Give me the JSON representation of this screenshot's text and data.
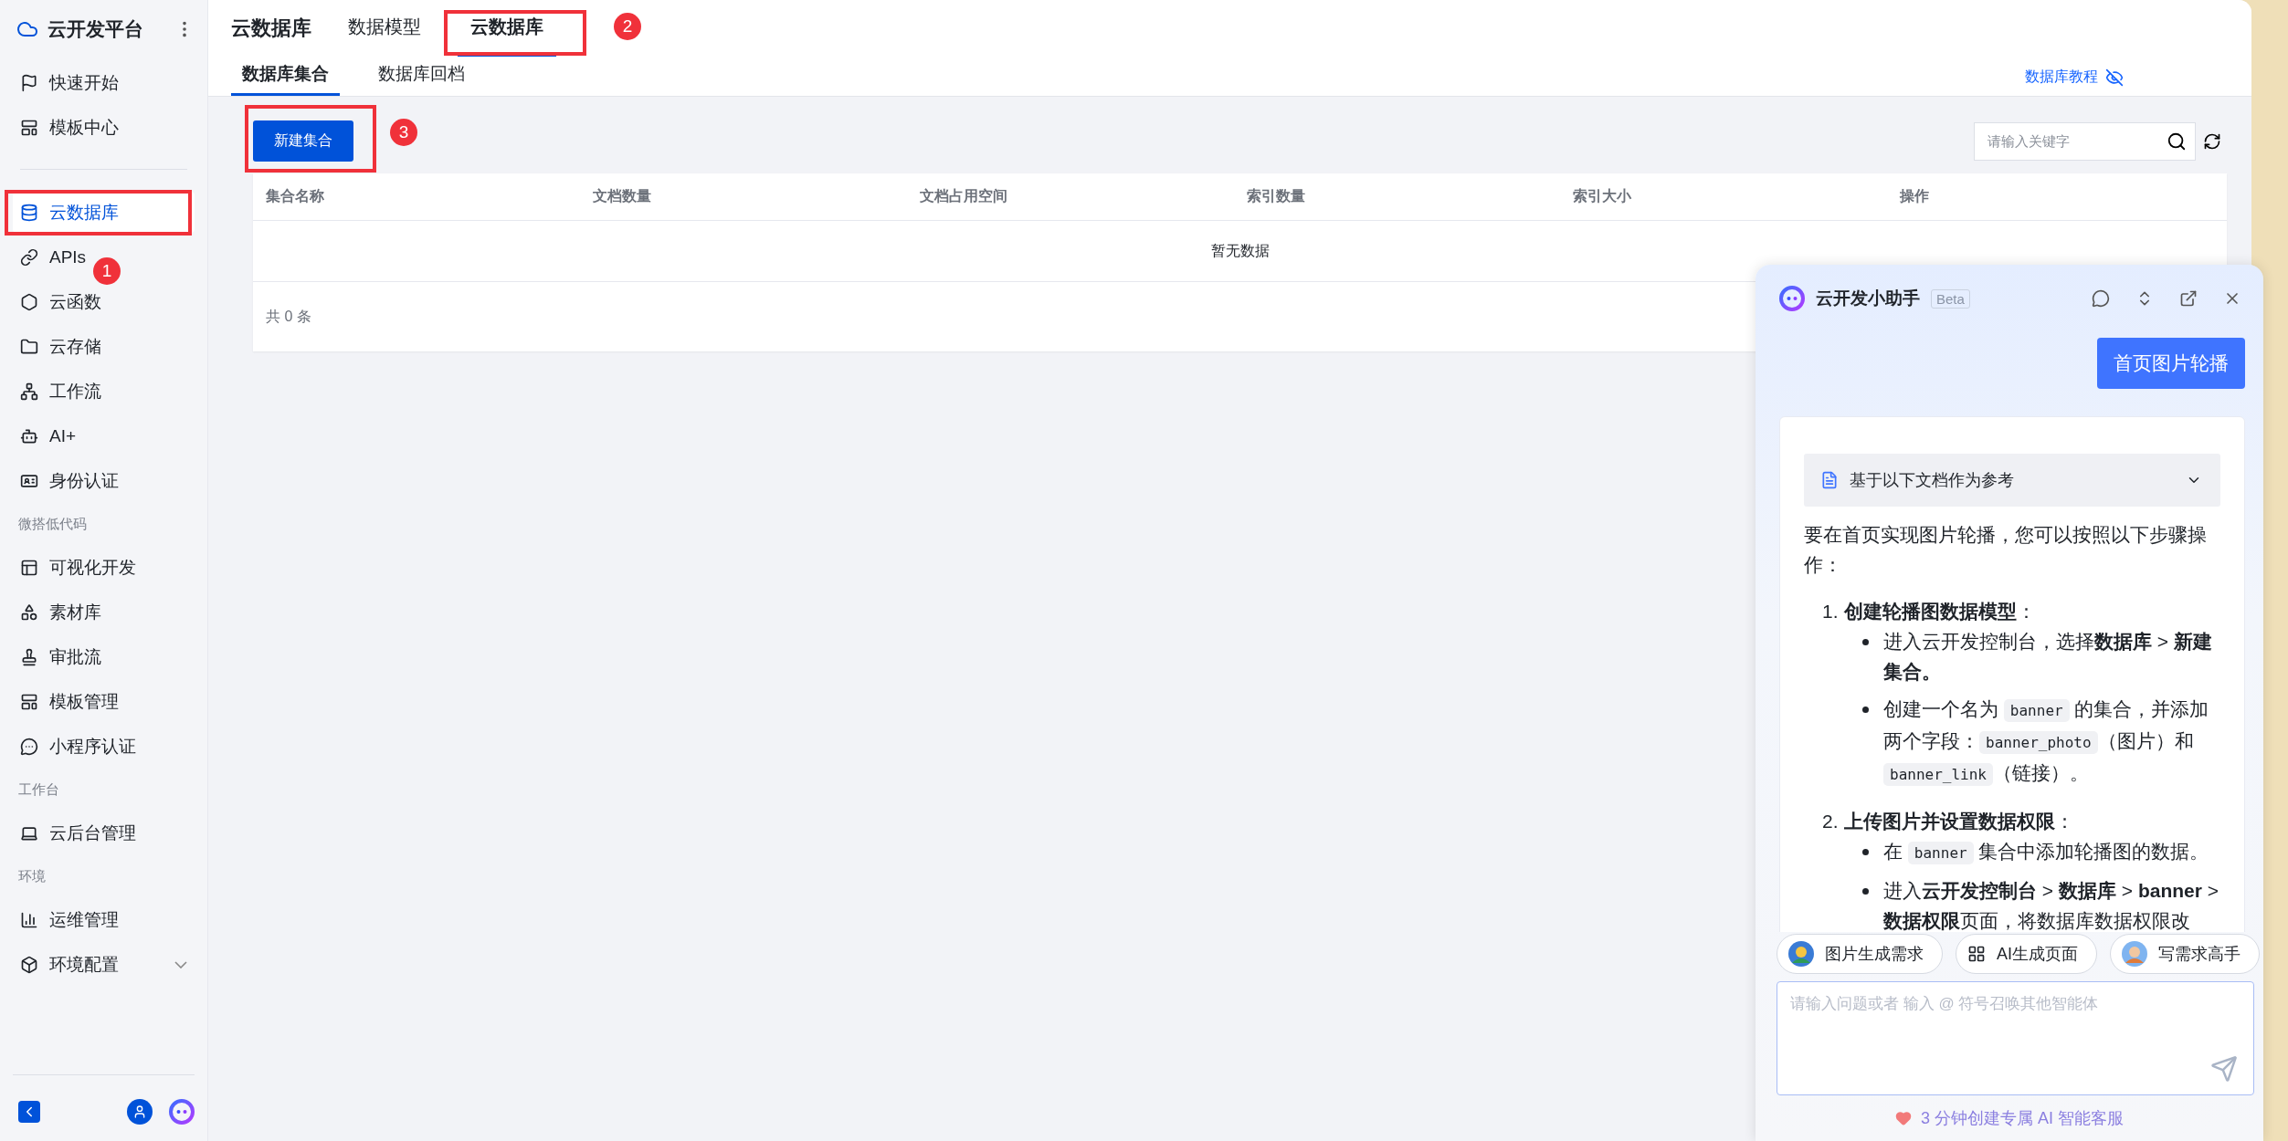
{
  "sidebar": {
    "brand": "云开发平台",
    "groups": [
      {
        "items": [
          {
            "label": "快速开始",
            "selected": false,
            "submenu": false
          },
          {
            "label": "模板中心",
            "selected": false,
            "submenu": false
          }
        ]
      },
      {
        "items": [
          {
            "label": "云数据库",
            "selected": true,
            "submenu": false
          },
          {
            "label": "APIs",
            "selected": false,
            "submenu": false
          },
          {
            "label": "云函数",
            "selected": false,
            "submenu": false
          },
          {
            "label": "云存储",
            "selected": false,
            "submenu": false
          },
          {
            "label": "工作流",
            "selected": false,
            "submenu": false
          },
          {
            "label": "AI+",
            "selected": false,
            "submenu": false
          },
          {
            "label": "身份认证",
            "selected": false,
            "submenu": false
          }
        ]
      },
      {
        "heading": "微搭低代码",
        "items": [
          {
            "label": "可视化开发",
            "selected": false,
            "submenu": false
          },
          {
            "label": "素材库",
            "selected": false,
            "submenu": false
          },
          {
            "label": "审批流",
            "selected": false,
            "submenu": false
          },
          {
            "label": "模板管理",
            "selected": false,
            "submenu": false
          },
          {
            "label": "小程序认证",
            "selected": false,
            "submenu": false
          }
        ]
      },
      {
        "heading": "工作台",
        "items": [
          {
            "label": "云后台管理",
            "selected": false,
            "submenu": false
          }
        ]
      },
      {
        "heading": "环境",
        "items": [
          {
            "label": "运维管理",
            "selected": false,
            "submenu": false
          },
          {
            "label": "环境配置",
            "selected": false,
            "submenu": true
          }
        ]
      }
    ]
  },
  "header": {
    "title": "云数据库",
    "tabs": [
      {
        "label": "数据模型",
        "selected": false
      },
      {
        "label": "云数据库",
        "selected": true
      }
    ],
    "subtabs": [
      {
        "label": "数据库集合",
        "selected": true
      },
      {
        "label": "数据库回档",
        "selected": false
      }
    ],
    "tutorial_link": "数据库教程"
  },
  "toolbar": {
    "create_button": "新建集合",
    "search": {
      "placeholder": "请输入关键字"
    }
  },
  "table": {
    "columns": [
      "集合名称",
      "文档数量",
      "文档占用空间",
      "索引数量",
      "索引大小",
      "操作"
    ],
    "empty_text": "暂无数据",
    "total": "共 0 条"
  },
  "annotations": [
    {
      "number": "1"
    },
    {
      "number": "2"
    },
    {
      "number": "3"
    }
  ],
  "assistant": {
    "title": "云开发小助手",
    "badge": "Beta",
    "user_message": "首页图片轮播",
    "reference": "基于以下文档作为参考",
    "intro": "要在首页实现图片轮播，您可以按照以下步骤操作：",
    "steps": [
      {
        "number": "1.",
        "title": "**创建轮播图数据模型**：",
        "bullets": [
          [
            {
              "kind": "text",
              "text": "进入云开发控制台，选择**数据库** > **新建集合。**"
            }
          ],
          [
            {
              "kind": "text",
              "text": "创建一个名为 "
            },
            {
              "kind": "code",
              "text": "banner"
            },
            {
              "kind": "text",
              "text": " 的集合，并添加两个字段："
            },
            {
              "kind": "code",
              "text": "banner_photo"
            },
            {
              "kind": "text",
              "text": "（图片）和 "
            },
            {
              "kind": "code",
              "text": "banner_link"
            },
            {
              "kind": "text",
              "text": "（链接）。"
            }
          ]
        ]
      },
      {
        "number": "2.",
        "title": "**上传图片并设置数据权限**：",
        "bullets": [
          [
            {
              "kind": "text",
              "text": "在 "
            },
            {
              "kind": "code",
              "text": "banner"
            },
            {
              "kind": "text",
              "text": " 集合中添加轮播图的数据。"
            }
          ],
          [
            {
              "kind": "text",
              "text": "进入**云开发控制台** > **数据库** > **banner** > **数据权限**页面，将数据库数据权限改"
            }
          ]
        ]
      }
    ],
    "chips": [
      {
        "label": "图片生成需求",
        "kind": "avatar"
      },
      {
        "label": "AI生成页面",
        "kind": "grid"
      },
      {
        "label": "写需求高手",
        "kind": "avatar"
      }
    ],
    "input": {
      "placeholder": "请输入问题或者 输入 @ 符号召唤其他智能体"
    },
    "footer": "3 分钟创建专属 AI 智能客服"
  }
}
